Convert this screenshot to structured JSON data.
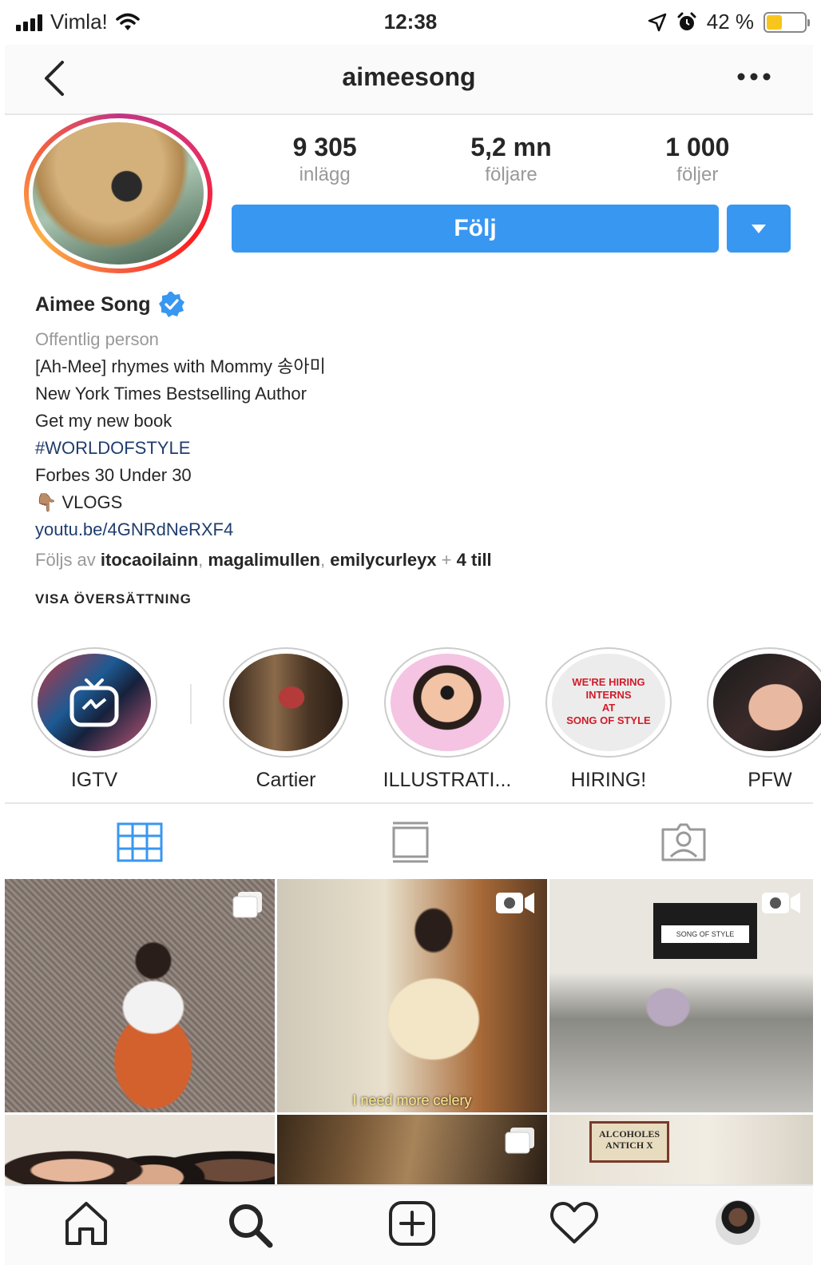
{
  "status": {
    "carrier": "Vimla!",
    "time": "12:38",
    "battery_pct_text": "42 %",
    "battery_level": 0.42,
    "battery_color": "#f7c51c"
  },
  "nav": {
    "title": "aimeesong",
    "back_icon": "chevron-left-icon",
    "more_icon": "more-horizontal-icon"
  },
  "profile": {
    "stats": [
      {
        "value": "9 305",
        "label": "inlägg"
      },
      {
        "value": "5,2 mn",
        "label": "följare"
      },
      {
        "value": "1 000",
        "label": "följer"
      }
    ],
    "follow_label": "Följ",
    "accent_color": "#3897f0"
  },
  "bio": {
    "name": "Aimee Song",
    "category": "Offentlig person",
    "lines": [
      "[Ah-Mee] rhymes with Mommy 송아미",
      "New York Times Bestselling Author",
      "Get my new book"
    ],
    "hashtag": "#WORLDOFSTYLE",
    "line_forbes": "Forbes 30 Under 30",
    "vlogs": "👇🏽 VLOGS",
    "link": "youtu.be/4GNRdNeRXF4",
    "followed_prefix": "Följs av",
    "followers": [
      "itocaoilainn",
      "magalimullen",
      "emilycurleyx"
    ],
    "followed_more": "+ 4 till",
    "translate": "VISA ÖVERSÄTTNING"
  },
  "highlights": [
    {
      "label": "IGTV"
    },
    {
      "label": "Cartier"
    },
    {
      "label": "ILLUSTRATI..."
    },
    {
      "label": "HIRING!",
      "image_text": [
        "WE'RE HIRING",
        "INTERNS",
        "AT",
        "SONG OF STYLE"
      ]
    },
    {
      "label": "PFW"
    }
  ],
  "tabs": [
    {
      "icon": "grid-icon",
      "active": true
    },
    {
      "icon": "feed-list-icon",
      "active": false
    },
    {
      "icon": "tagged-person-icon",
      "active": false
    }
  ],
  "posts": {
    "video_caption": "I need more celery",
    "screen_text": "SONG OF STYLE",
    "sign_text": [
      "ALCOHOLES",
      "ANTICH X"
    ]
  },
  "bottom_nav": [
    "home-icon",
    "search-icon",
    "add-post-icon",
    "heart-icon",
    "profile-avatar"
  ]
}
